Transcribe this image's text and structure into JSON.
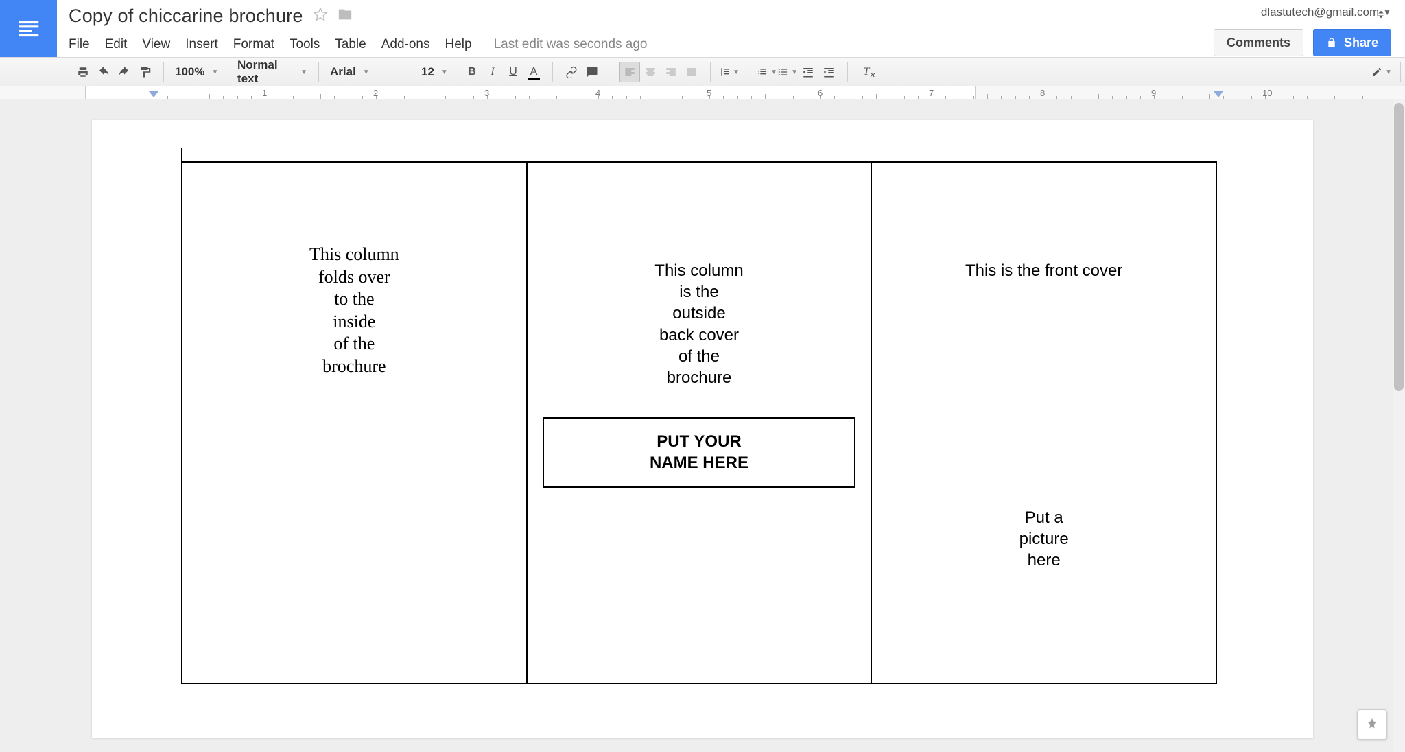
{
  "account_email": "dlastutech@gmail.com",
  "doc": {
    "title": "Copy of chiccarine brochure"
  },
  "menubar": [
    "File",
    "Edit",
    "View",
    "Insert",
    "Format",
    "Tools",
    "Table",
    "Add-ons",
    "Help"
  ],
  "last_edit": "Last edit was seconds ago",
  "buttons": {
    "comments": "Comments",
    "share": "Share"
  },
  "toolbar": {
    "zoom": "100%",
    "style": "Normal text",
    "font": "Arial",
    "font_size": "12"
  },
  "ruler": {
    "numbers": [
      "1",
      "2",
      "3",
      "4",
      "5",
      "6",
      "7",
      "8",
      "9",
      "10"
    ]
  },
  "brochure": {
    "col1": "This column\nfolds over\nto the\ninside\nof the\nbrochure",
    "col2": "This column\nis the\noutside\nback cover\nof the\nbrochure",
    "col2_name_box": "PUT YOUR\nNAME HERE",
    "col3_top": "This is the front cover",
    "col3_pic": "Put a\npicture\nhere"
  }
}
